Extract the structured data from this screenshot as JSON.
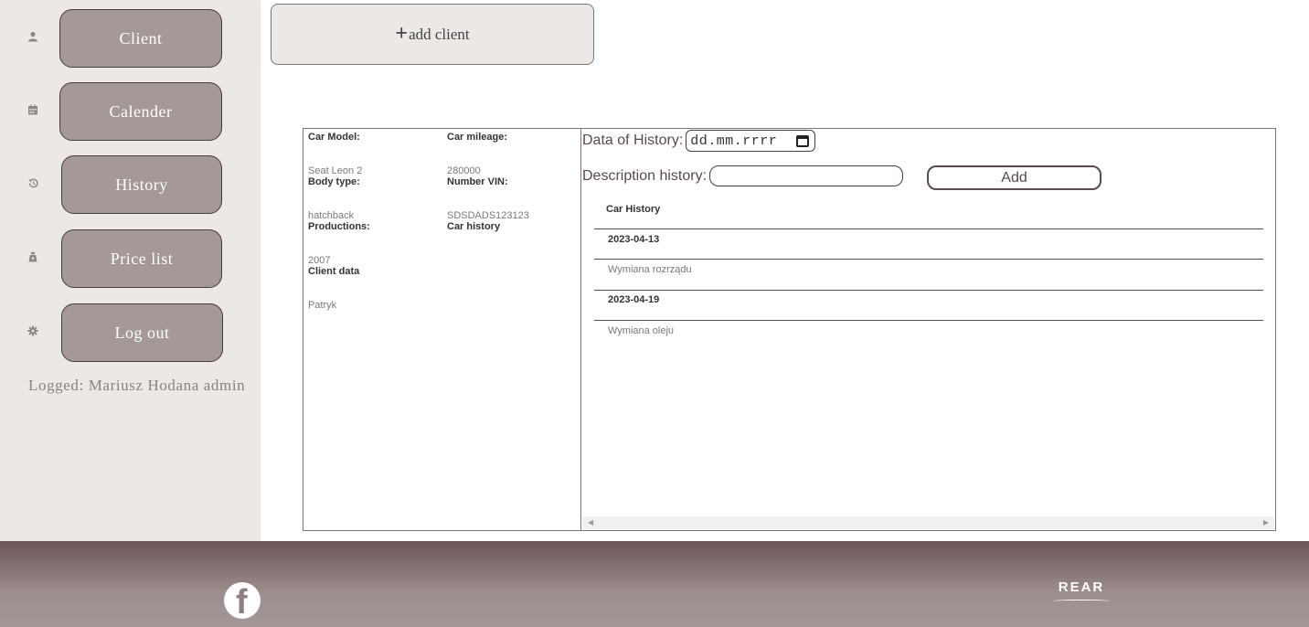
{
  "sidebar": {
    "items": [
      {
        "label": "Client",
        "icon": "person-icon"
      },
      {
        "label": "Calender",
        "icon": "calendar-icon"
      },
      {
        "label": "History",
        "icon": "history-icon"
      },
      {
        "label": "Price list",
        "icon": "tag-icon"
      },
      {
        "label": "Log out",
        "icon": "gear-icon"
      }
    ],
    "logged_text": "Logged: Mariusz Hodana admin"
  },
  "header": {
    "add_client_label": "add client",
    "add_client_plus": "+"
  },
  "car_info": {
    "car_model_label": "Car Model:",
    "car_model_value": "Seat Leon 2",
    "car_mileage_label": "Car mileage:",
    "car_mileage_value": "280000",
    "body_type_label": "Body type:",
    "body_type_value": "hatchback",
    "vin_label": "Number VIN:",
    "vin_value": "SDSDADS123123",
    "productions_label": "Productions:",
    "productions_value": "2007",
    "car_history_label": "Car history",
    "client_data_label": "Client data",
    "client_data_value": "Patryk"
  },
  "history_form": {
    "date_label": "Data of History:",
    "date_placeholder": "dd.mm.rrrr",
    "description_label": "Description history:",
    "description_value": "",
    "add_label": "Add"
  },
  "car_history": {
    "title": "Car History",
    "entries": [
      {
        "date": "2023-04-13",
        "description": "Wymiana rozrządu"
      },
      {
        "date": "2023-04-19",
        "description": "Wymiana oleju"
      }
    ]
  },
  "footer": {
    "brand": "REAR"
  },
  "colors": {
    "sidebar_bg": "#ece8e6",
    "button_bg": "#a49997",
    "accent": "#5a4a4c",
    "footer_top": "#6d5557",
    "footer_bottom": "#a39797"
  }
}
